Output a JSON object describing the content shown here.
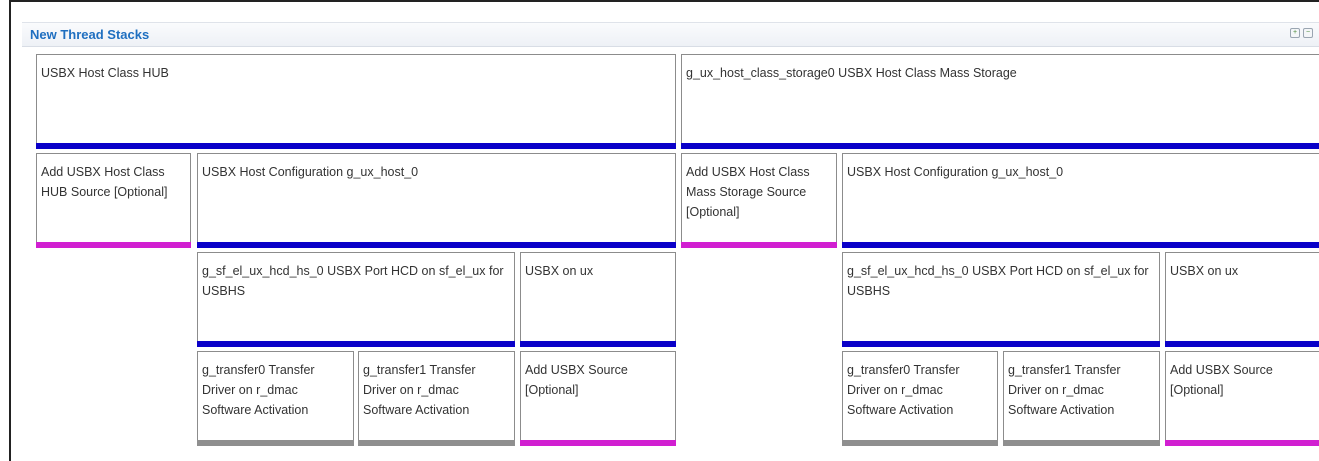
{
  "panel": {
    "title": "New Thread Stacks",
    "icons": [
      "add-icon",
      "remove-icon"
    ]
  },
  "stacks": [
    {
      "top": {
        "label": "USBX Host Class HUB"
      },
      "source": {
        "label": "Add USBX Host Class HUB Source [Optional]"
      },
      "config": {
        "label": "USBX Host Configuration g_ux_host_0"
      },
      "hcd": {
        "label": "g_sf_el_ux_hcd_hs_0 USBX Port HCD on sf_el_ux for USBHS"
      },
      "usbx": {
        "label": "USBX on ux"
      },
      "transfer0": {
        "label": "g_transfer0 Transfer Driver on r_dmac Software Activation"
      },
      "transfer1": {
        "label": "g_transfer1 Transfer Driver on r_dmac Software Activation"
      },
      "add_source": {
        "label": "Add USBX Source [Optional]"
      }
    },
    {
      "top": {
        "label": "g_ux_host_class_storage0 USBX Host Class Mass Storage"
      },
      "source": {
        "label": "Add USBX Host Class Mass Storage Source [Optional]"
      },
      "config": {
        "label": "USBX Host Configuration g_ux_host_0"
      },
      "hcd": {
        "label": "g_sf_el_ux_hcd_hs_0 USBX Port HCD on sf_el_ux for USBHS"
      },
      "usbx": {
        "label": "USBX on ux"
      },
      "transfer0": {
        "label": "g_transfer0 Transfer Driver on r_dmac Software Activation"
      },
      "transfer1": {
        "label": "g_transfer1 Transfer Driver on r_dmac Software Activation"
      },
      "add_source": {
        "label": "Add USBX Source [Optional]"
      }
    }
  ],
  "colors": {
    "title": "#1f6fc0",
    "module_bar": "#0a00c8",
    "optional_bar": "#d11fd1",
    "driver_bar": "#8f8f8f"
  }
}
